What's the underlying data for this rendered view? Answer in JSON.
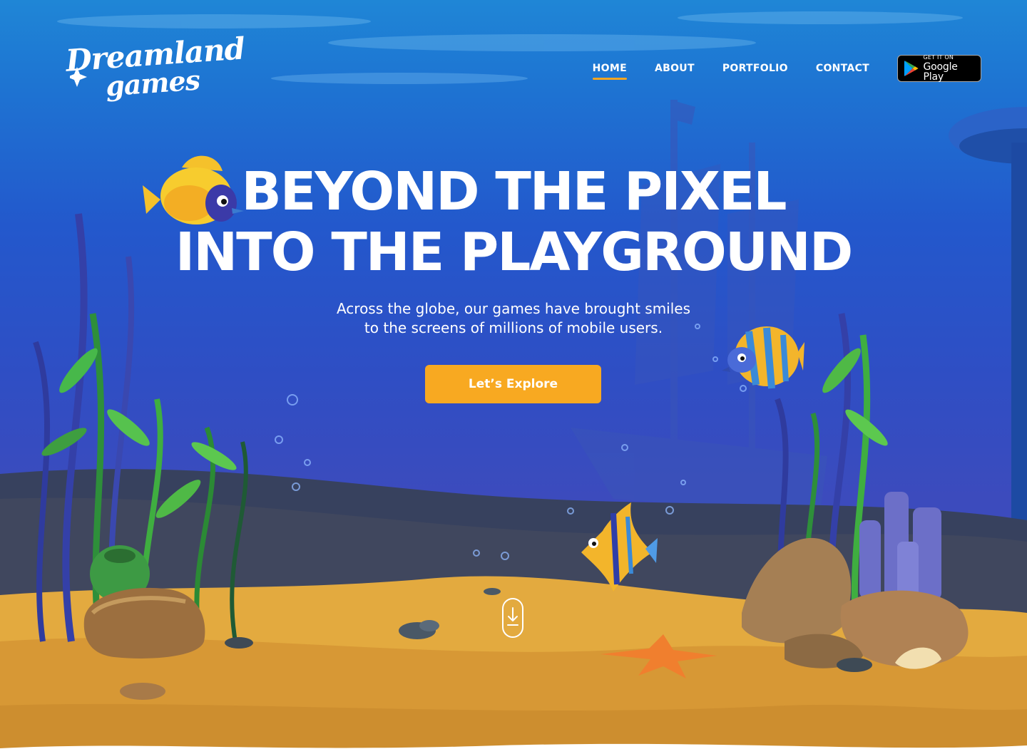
{
  "brand": {
    "logo_line1": "Dreamland",
    "logo_line2": "games"
  },
  "nav": {
    "items": [
      {
        "label": "HOME",
        "active": true
      },
      {
        "label": "ABOUT",
        "active": false
      },
      {
        "label": "PORTFOLIO",
        "active": false
      },
      {
        "label": "CONTACT",
        "active": false
      }
    ],
    "store_badge": {
      "small": "GET IT ON",
      "big": "Google Play"
    }
  },
  "hero": {
    "title_line1": "BEYOND THE PIXEL",
    "title_line2": "INTO THE PLAYGROUND",
    "subtitle_line1": "Across the globe, our games have brought smiles",
    "subtitle_line2": "to the screens of millions of mobile users.",
    "cta_label": "Let’s Explore"
  },
  "icons": {
    "scroll": "scroll-down-icon",
    "store": "google-play-icon"
  },
  "colors": {
    "accent": "#f8a921",
    "sky_top": "#1f86d6",
    "sky_bottom": "#3c4bbd",
    "sand": "#e3aa3f",
    "nav_underline": "#f5a623"
  }
}
